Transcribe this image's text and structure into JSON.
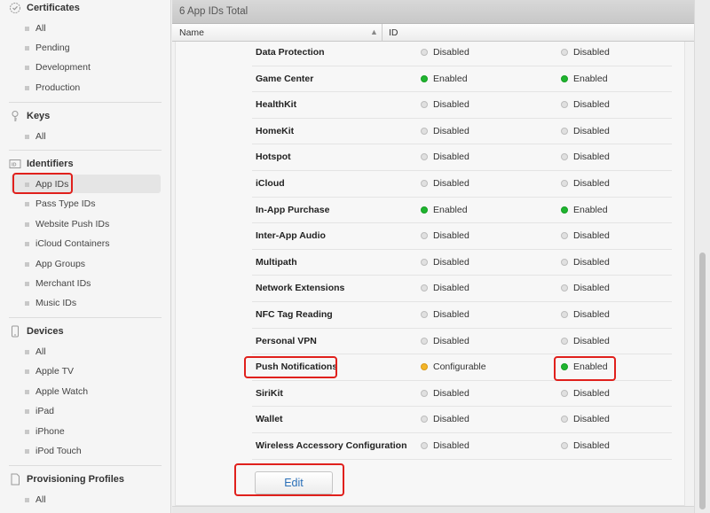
{
  "sidebar": {
    "certificates": {
      "title": "Certificates",
      "items": [
        "All",
        "Pending",
        "Development",
        "Production"
      ]
    },
    "keys": {
      "title": "Keys",
      "items": [
        "All"
      ]
    },
    "identifiers": {
      "title": "Identifiers",
      "items": [
        "App IDs",
        "Pass Type IDs",
        "Website Push IDs",
        "iCloud Containers",
        "App Groups",
        "Merchant IDs",
        "Music IDs"
      ],
      "selected": "App IDs"
    },
    "devices": {
      "title": "Devices",
      "items": [
        "All",
        "Apple TV",
        "Apple Watch",
        "iPad",
        "iPhone",
        "iPod Touch"
      ]
    },
    "profiles": {
      "title": "Provisioning Profiles",
      "items": [
        "All"
      ]
    }
  },
  "header": {
    "total": "6 App IDs Total",
    "col_name": "Name",
    "col_id": "ID",
    "sort_indicator": "▲"
  },
  "services": [
    {
      "name": "Data Protection",
      "development": "Disabled",
      "distribution": "Disabled"
    },
    {
      "name": "Game Center",
      "development": "Enabled",
      "distribution": "Enabled"
    },
    {
      "name": "HealthKit",
      "development": "Disabled",
      "distribution": "Disabled"
    },
    {
      "name": "HomeKit",
      "development": "Disabled",
      "distribution": "Disabled"
    },
    {
      "name": "Hotspot",
      "development": "Disabled",
      "distribution": "Disabled"
    },
    {
      "name": "iCloud",
      "development": "Disabled",
      "distribution": "Disabled"
    },
    {
      "name": "In-App Purchase",
      "development": "Enabled",
      "distribution": "Enabled"
    },
    {
      "name": "Inter-App Audio",
      "development": "Disabled",
      "distribution": "Disabled"
    },
    {
      "name": "Multipath",
      "development": "Disabled",
      "distribution": "Disabled"
    },
    {
      "name": "Network Extensions",
      "development": "Disabled",
      "distribution": "Disabled"
    },
    {
      "name": "NFC Tag Reading",
      "development": "Disabled",
      "distribution": "Disabled"
    },
    {
      "name": "Personal VPN",
      "development": "Disabled",
      "distribution": "Disabled"
    },
    {
      "name": "Push Notifications",
      "development": "Configurable",
      "distribution": "Enabled"
    },
    {
      "name": "SiriKit",
      "development": "Disabled",
      "distribution": "Disabled"
    },
    {
      "name": "Wallet",
      "development": "Disabled",
      "distribution": "Disabled"
    },
    {
      "name": "Wireless Accessory Configuration",
      "development": "Disabled",
      "distribution": "Disabled"
    }
  ],
  "edit_label": "Edit",
  "status_colors": {
    "Disabled": "#e0e0e0",
    "Enabled": "#1fb42f",
    "Configurable": "#f3b527"
  },
  "highlight_color": "#e0201c"
}
